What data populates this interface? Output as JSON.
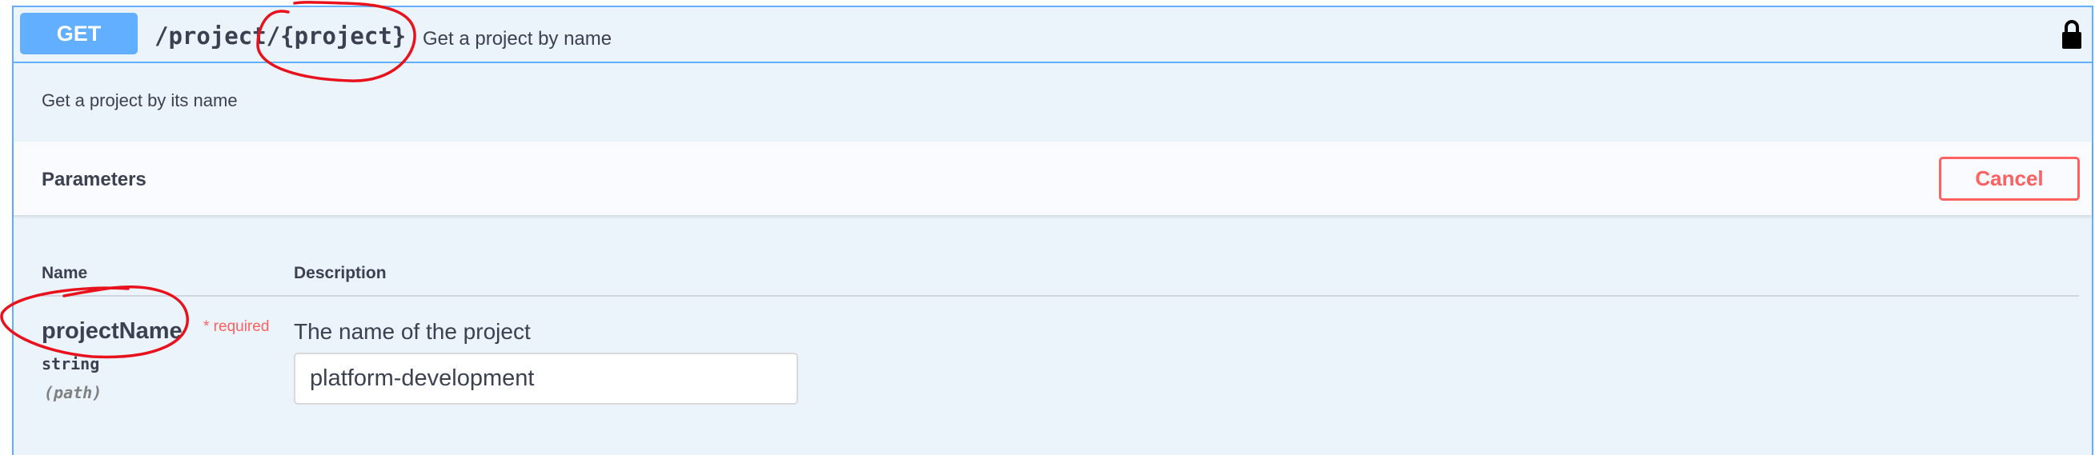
{
  "operation": {
    "method": "GET",
    "path": "/project/{project}",
    "summary": "Get a project by name",
    "description": "Get a project by its name",
    "lock_icon": "lock-icon"
  },
  "parameters": {
    "title": "Parameters",
    "cancel_label": "Cancel",
    "column_name": "Name",
    "column_description": "Description",
    "items": [
      {
        "name": "projectName",
        "required_label": "* required",
        "type": "string",
        "in": "(path)",
        "description": "The name of the project",
        "value": "platform-development"
      }
    ]
  },
  "colors": {
    "method_get": "#61affe",
    "cancel": "#ff6060",
    "annotation": "#e8121c"
  }
}
